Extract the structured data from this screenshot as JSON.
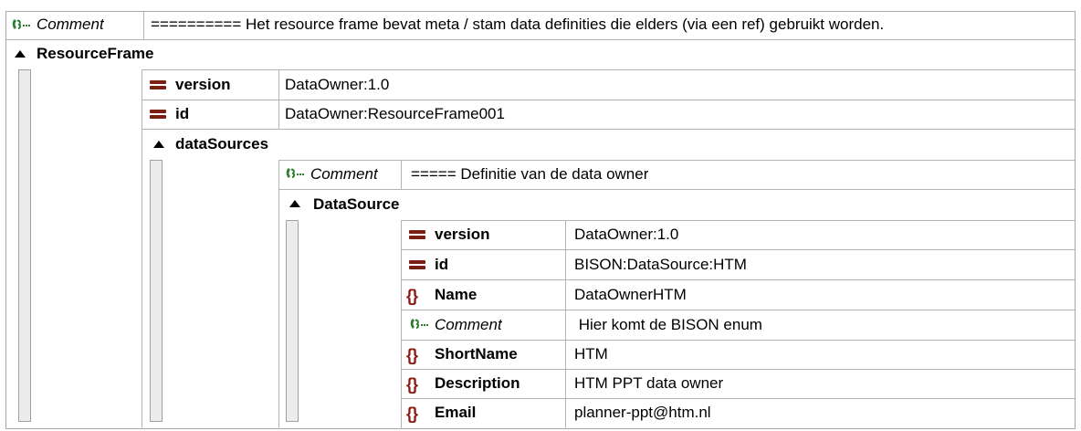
{
  "header": {
    "comment_label": "Comment",
    "comment_text": "========== Het resource frame bevat meta / stam data definities die elders (via een ref) gebruikt worden."
  },
  "resource_frame": {
    "label": "ResourceFrame",
    "version": {
      "label": "version",
      "value": "DataOwner:1.0"
    },
    "id": {
      "label": "id",
      "value": "DataOwner:ResourceFrame001"
    },
    "data_sources": {
      "label": "dataSources",
      "comment_label": "Comment",
      "comment_text": "===== Definitie van de data owner",
      "data_source": {
        "label": "DataSource",
        "rows": [
          {
            "icon": "equals-icon",
            "label": "version",
            "value": "DataOwner:1.0"
          },
          {
            "icon": "equals-icon",
            "label": "id",
            "value": "BISON:DataSource:HTM"
          },
          {
            "icon": "braces-icon",
            "label": "Name",
            "value": "DataOwnerHTM"
          },
          {
            "icon": "comment-icon",
            "label": "Comment",
            "value": " Hier komt de BISON enum"
          },
          {
            "icon": "braces-icon",
            "label": "ShortName",
            "value": "HTM"
          },
          {
            "icon": "braces-icon",
            "label": "Description",
            "value": "HTM PPT data owner"
          },
          {
            "icon": "braces-icon",
            "label": "Email",
            "value": "planner-ppt@htm.nl"
          }
        ]
      }
    }
  },
  "colors": {
    "attribute_icon": "#7a1f14",
    "element_icon": "#8b1a10",
    "comment_icon": "#2e7d32",
    "grid_line": "#b4b4b4"
  }
}
